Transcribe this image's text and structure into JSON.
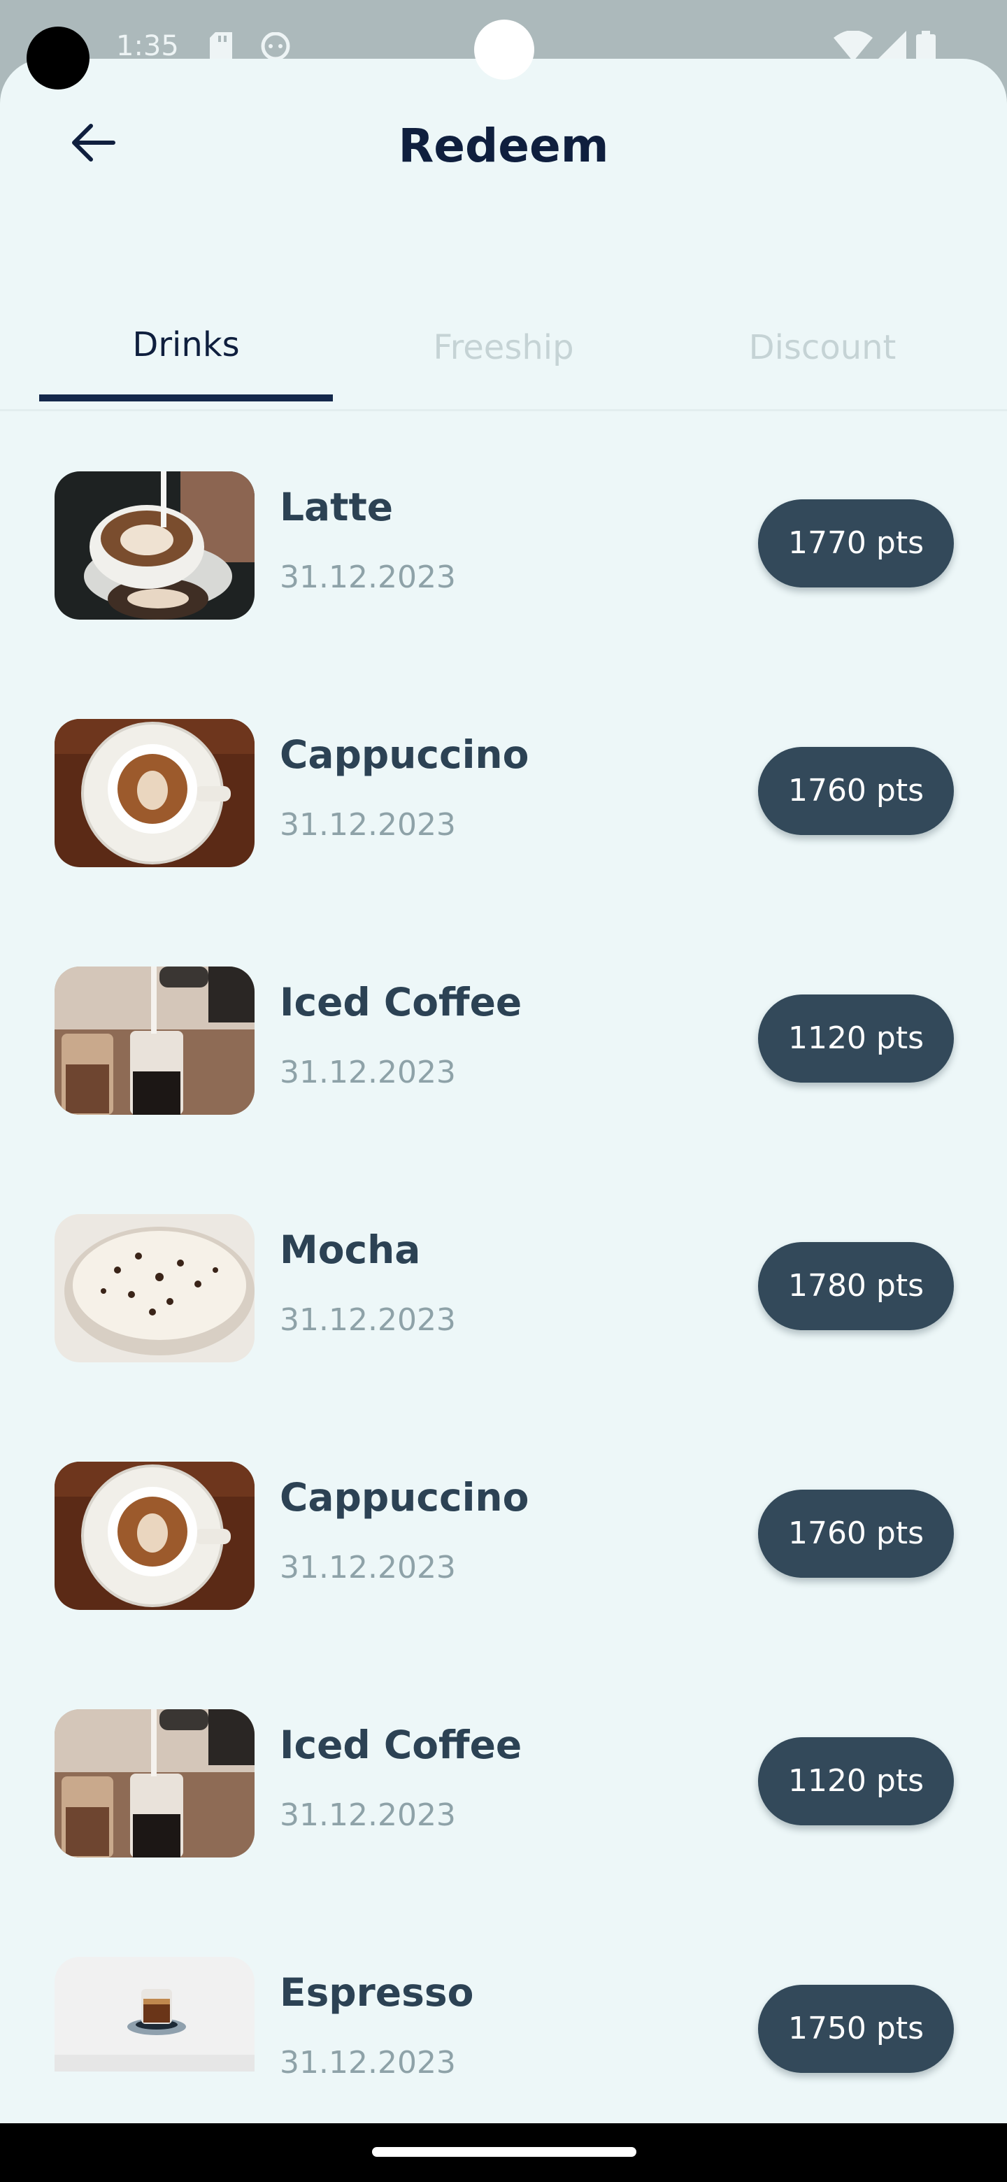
{
  "status_bar": {
    "time": "1:35",
    "icons": [
      "sd-card-icon",
      "android-face-icon",
      "wifi-icon",
      "signal-icon",
      "battery-icon"
    ]
  },
  "header": {
    "back_icon": "arrow-left-icon",
    "title": "Redeem"
  },
  "tabs": [
    {
      "label": "Drinks",
      "active": true
    },
    {
      "label": "Freeship",
      "active": false
    },
    {
      "label": "Discount",
      "active": false
    }
  ],
  "items": [
    {
      "name": "Latte",
      "date": "31.12.2023",
      "points": "1770 pts",
      "image": "latte-photo"
    },
    {
      "name": "Cappuccino",
      "date": "31.12.2023",
      "points": "1760 pts",
      "image": "cappuccino-photo"
    },
    {
      "name": "Iced Coffee",
      "date": "31.12.2023",
      "points": "1120 pts",
      "image": "iced-coffee-photo"
    },
    {
      "name": "Mocha",
      "date": "31.12.2023",
      "points": "1780 pts",
      "image": "mocha-photo"
    },
    {
      "name": "Cappuccino",
      "date": "31.12.2023",
      "points": "1760 pts",
      "image": "cappuccino-photo"
    },
    {
      "name": "Iced Coffee",
      "date": "31.12.2023",
      "points": "1120 pts",
      "image": "iced-coffee-photo"
    },
    {
      "name": "Espresso",
      "date": "31.12.2023",
      "points": "1750 pts",
      "image": "espresso-photo"
    }
  ],
  "colors": {
    "background": "#edf7f8",
    "title": "#0f1f3e",
    "item_name": "#2c4254",
    "item_date": "#8ea2a8",
    "points_button": "#33495a",
    "tab_indicator": "#14284b",
    "tab_inactive": "#c5d3d5"
  }
}
